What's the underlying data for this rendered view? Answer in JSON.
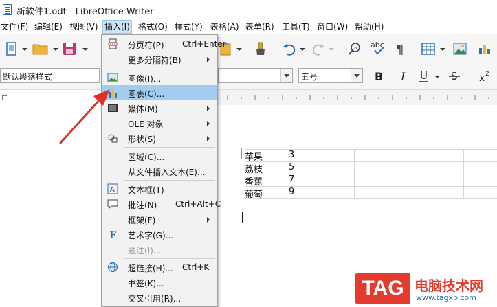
{
  "window": {
    "title": "新软件1.odt - LibreOffice Writer"
  },
  "menubar": {
    "items": [
      "文件(F)",
      "编辑(E)",
      "视图(V)",
      "插入(I)",
      "格式(O)",
      "样式(Y)",
      "表格(A)",
      "表单(R)",
      "工具(T)",
      "窗口(W)",
      "帮助(H)"
    ]
  },
  "format_bar": {
    "paragraph_style": "默认段落样式",
    "font_size": "五号"
  },
  "insert_menu": {
    "items": [
      {
        "label": "分页符(P)",
        "shortcut": "Ctrl+Enter"
      },
      {
        "label": "更多分隔符(B)"
      },
      {
        "label": "图像(I)..."
      },
      {
        "label": "图表(C)..."
      },
      {
        "label": "媒体(M)"
      },
      {
        "label": "OLE 对象"
      },
      {
        "label": "形状(S)"
      },
      {
        "label": "区域(C)..."
      },
      {
        "label": "从文件插入文本(E)..."
      },
      {
        "label": "文本框(T)"
      },
      {
        "label": "批注(N)",
        "shortcut": "Ctrl+Alt+C"
      },
      {
        "label": "框架(F)"
      },
      {
        "label": "艺术字(G)..."
      },
      {
        "label": "题注(I)..."
      },
      {
        "label": "超链接(H)...",
        "shortcut": "Ctrl+K"
      },
      {
        "label": "书签(K)..."
      },
      {
        "label": "交叉引用(R)..."
      }
    ]
  },
  "table": {
    "rows": [
      [
        "苹果",
        "3"
      ],
      [
        "荔枝",
        "5"
      ],
      [
        "香蕉",
        "7"
      ],
      [
        "葡萄",
        "9"
      ]
    ]
  },
  "watermark": {
    "brand": "TAG",
    "site_name": "电脑技术网",
    "url": "www.tagxp.com"
  },
  "colors": {
    "highlight": "#a3cdf0",
    "arrow": "#e0302a",
    "brand_red": "#e33b2d"
  }
}
